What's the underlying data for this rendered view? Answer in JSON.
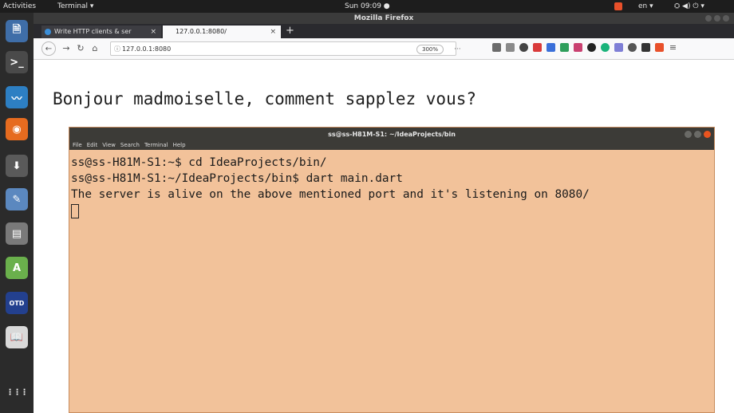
{
  "topbar": {
    "activities": "Activities",
    "app_menu": "Terminal ▾",
    "clock": "Sun 09:09 ●",
    "lang": "en ▾",
    "status": "⛭ ◀) ⏻ ▾"
  },
  "window": {
    "title": "Mozilla Firefox"
  },
  "tabs": [
    {
      "label": "Write HTTP clients & ser",
      "close": "×"
    },
    {
      "label": "127.0.0.1:8080/",
      "close": "×"
    }
  ],
  "newtab": "+",
  "nav": {
    "back": "←",
    "forward": "→",
    "reload": "↻",
    "home": "⌂",
    "url": "127.0.0.1:8080",
    "info": "ⓘ",
    "zoom": "300%",
    "actions": "··· ♡ ☆"
  },
  "page": {
    "headline": "Bonjour madmoiselle, comment sapplez vous?"
  },
  "terminal": {
    "title": "ss@ss-H81M-S1: ~/IdeaProjects/bin",
    "menu": [
      "File",
      "Edit",
      "View",
      "Search",
      "Terminal",
      "Help"
    ],
    "lines": [
      "ss@ss-H81M-S1:~$ cd IdeaProjects/bin/",
      "ss@ss-H81M-S1:~/IdeaProjects/bin$ dart main.dart",
      "The server is alive on the above mentioned port and it's listening on 8080/"
    ]
  },
  "dock": [
    {
      "name": "files-icon",
      "glyph": "🗎",
      "color": "#3f6ea8"
    },
    {
      "name": "terminal-icon",
      "glyph": ">_",
      "color": "#4a4a4a"
    },
    {
      "name": "system-monitor-icon",
      "glyph": "〰",
      "color": "#2d7fc3"
    },
    {
      "name": "firefox-icon",
      "glyph": "◉",
      "color": "#e66b1f"
    },
    {
      "name": "install-icon",
      "glyph": "⬇",
      "color": "#5a5a5a"
    },
    {
      "name": "text-editor-icon",
      "glyph": "✎",
      "color": "#5b88bf"
    },
    {
      "name": "file-cabinet-icon",
      "glyph": "▤",
      "color": "#7a7a7a"
    },
    {
      "name": "android-studio-icon",
      "glyph": "A",
      "color": "#6ab04c"
    },
    {
      "name": "otd-icon",
      "glyph": "OTD",
      "color": "#23408e"
    },
    {
      "name": "book-reader-icon",
      "glyph": "📖",
      "color": "#d9d9d9"
    }
  ],
  "dock_apps": "⋮⋮⋮",
  "colors": {
    "terminal_bg": "#f2c29a",
    "titlebar": "#3c3b37",
    "dock": "#2b2b2b"
  }
}
